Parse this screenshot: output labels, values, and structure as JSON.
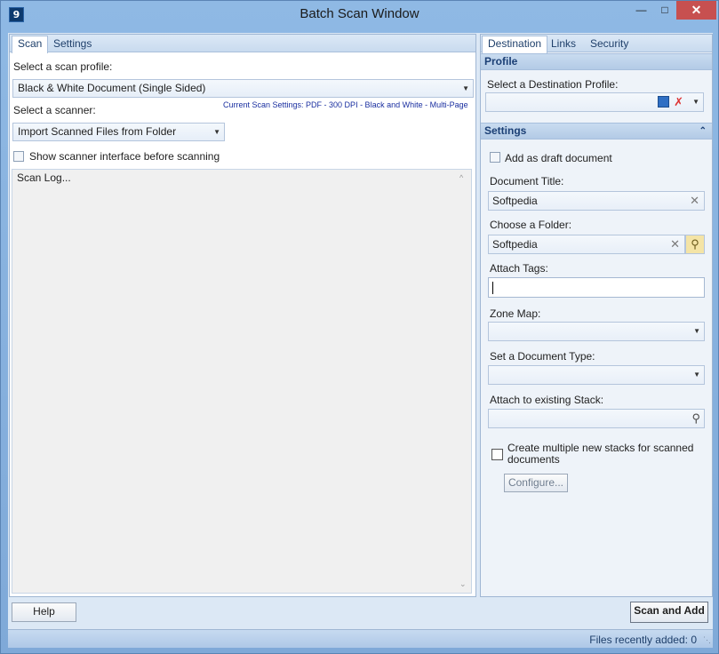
{
  "window": {
    "title": "Batch Scan Window",
    "app_icon": "9",
    "minimize": "—",
    "maximize": "□",
    "close": "✕"
  },
  "left": {
    "tabs": [
      "Scan",
      "Settings"
    ],
    "scan_profile_label": "Select a scan profile:",
    "scan_profile_value": "Black & White Document (Single Sided)",
    "scanner_label": "Select a scanner:",
    "current_settings": "Current Scan Settings: PDF - 300 DPI - Black and White - Multi-Page",
    "scanner_value": "Import Scanned Files from Folder",
    "show_interface_label": "Show scanner interface before scanning",
    "scan_log": "Scan Log..."
  },
  "right": {
    "tabs": [
      "Destination",
      "Links",
      "Security"
    ],
    "profile_header": "Profile",
    "dest_profile_label": "Select a Destination Profile:",
    "settings_header": "Settings",
    "draft_label": "Add as draft document",
    "doc_title_label": "Document Title:",
    "doc_title_value": "Softpedia",
    "folder_label": "Choose a Folder:",
    "folder_value": "Softpedia",
    "tags_label": "Attach Tags:",
    "zone_map_label": "Zone Map:",
    "doc_type_label": "Set a Document Type:",
    "stack_label": "Attach to existing Stack:",
    "multi_stack_label": "Create multiple new stacks for scanned documents",
    "configure_button": "Configure..."
  },
  "footer": {
    "help_button": "Help",
    "scan_add_button": "Scan and Add",
    "status": "Files recently added: 0"
  },
  "colors": {
    "frame": "#8fb9e4",
    "close_button": "#c75050",
    "section_header": "#b3cbe6",
    "link_text": "#1a2fa0"
  }
}
